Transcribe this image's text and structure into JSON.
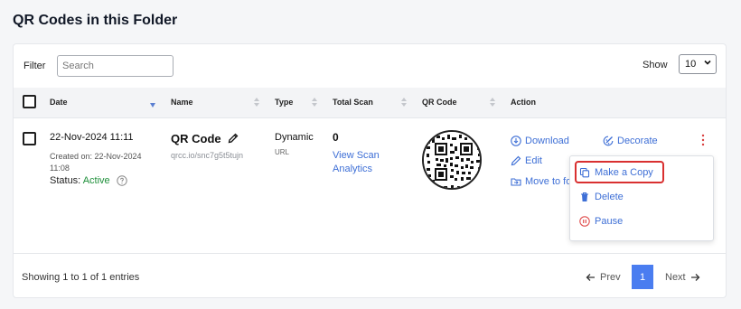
{
  "page": {
    "title": "QR Codes in this Folder"
  },
  "toolbar": {
    "filter_label": "Filter",
    "search_placeholder": "Search",
    "show_label": "Show",
    "show_value": "10"
  },
  "table": {
    "headers": [
      "Date",
      "Name",
      "Type",
      "Total Scan",
      "QR Code",
      "Action"
    ],
    "rows": [
      {
        "date": "22-Nov-2024 11:11",
        "created": "Created on: 22-Nov-2024 11:08",
        "status_label": "Status:",
        "status_value": "Active",
        "name": "QR Code",
        "url": "qrcc.io/snc7g5t5tujn",
        "type": "Dynamic",
        "type_sub": "URL",
        "scan_count": "0",
        "scan_link": "View Scan Analytics",
        "actions": {
          "download": "Download",
          "decorate": "Decorate",
          "edit": "Edit",
          "move": "Move to fo"
        }
      }
    ]
  },
  "dropdown_menu": {
    "items": [
      "Make a Copy",
      "Delete",
      "Pause"
    ]
  },
  "footer": {
    "showing": "Showing 1 to 1 of 1 entries",
    "prev": "Prev",
    "page": "1",
    "next": "Next"
  },
  "colors": {
    "link": "#3e6fd6",
    "active": "#1e8f3a",
    "highlight_border": "#d93030",
    "pager_active": "#4a7df0",
    "pause_icon": "#e05050"
  },
  "icons": [
    "pencil-icon",
    "help-icon",
    "download-icon",
    "decorate-icon",
    "edit-icon",
    "folder-move-icon",
    "kebab-menu-icon",
    "copy-icon",
    "trash-icon",
    "pause-icon",
    "arrow-left-icon",
    "arrow-right-icon",
    "chevron-down-icon",
    "sort-icon"
  ]
}
